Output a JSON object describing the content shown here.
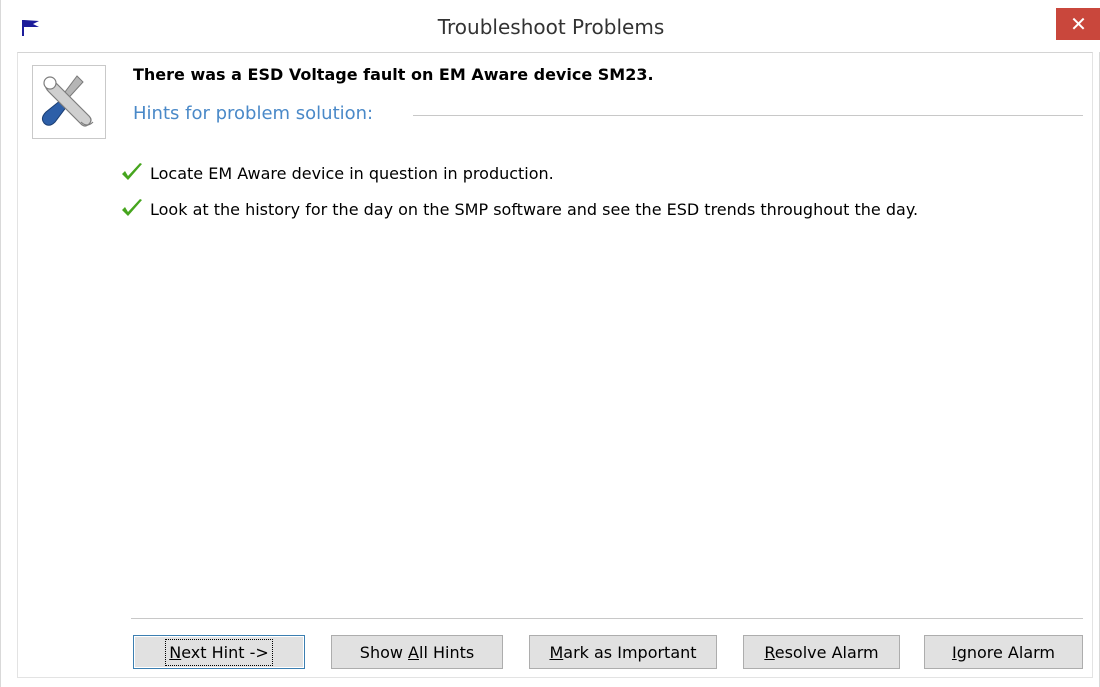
{
  "window": {
    "title": "Troubleshoot Problems",
    "close_glyph": "✕"
  },
  "message": {
    "fault": "There was a ESD Voltage fault on EM Aware device SM23.",
    "hints_header": "Hints for problem solution:"
  },
  "hints": [
    "Locate EM Aware device in question in production.",
    "Look at the history for the day on the SMP software and see the ESD trends throughout the day."
  ],
  "buttons": {
    "next_hint": {
      "mnemonic": "N",
      "rest": "ext Hint ->"
    },
    "show_all_hints": {
      "pre": "Show ",
      "mnemonic": "A",
      "rest": "ll Hints"
    },
    "mark_important": {
      "mnemonic": "M",
      "rest": "ark as Important"
    },
    "resolve_alarm": {
      "mnemonic": "R",
      "rest": "esolve Alarm"
    },
    "ignore_alarm": {
      "mnemonic": "I",
      "rest": "gnore Alarm"
    }
  },
  "icons": {
    "title": "flag-icon",
    "tools": "wrench-screwdriver-icon",
    "check": "checkmark-icon"
  },
  "colors": {
    "hints_header": "#4a89c8",
    "close_button": "#c9473c",
    "checkmark": "#46a51e",
    "flag": "#1c1c9a"
  }
}
